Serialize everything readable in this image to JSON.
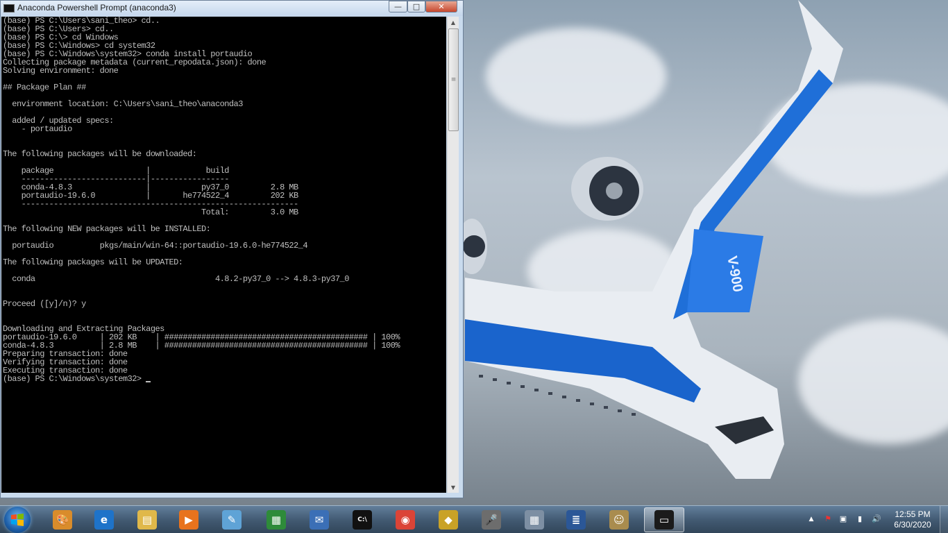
{
  "window": {
    "title": "Anaconda Powershell Prompt (anaconda3)",
    "minimize_glyph": "—",
    "maximize_glyph": "□",
    "close_glyph": "✕"
  },
  "console": {
    "lines": [
      "(base) PS C:\\Users\\sani_theo> cd..",
      "(base) PS C:\\Users> cd..",
      "(base) PS C:\\> cd Windows",
      "(base) PS C:\\Windows> cd system32",
      "(base) PS C:\\Windows\\system32> conda install portaudio",
      "Collecting package metadata (current_repodata.json): done",
      "Solving environment: done",
      "",
      "## Package Plan ##",
      "",
      "  environment location: C:\\Users\\sani_theo\\anaconda3",
      "",
      "  added / updated specs:",
      "    - portaudio",
      "",
      "",
      "The following packages will be downloaded:",
      "",
      "    package                    |            build",
      "    ---------------------------|-----------------",
      "    conda-4.8.3                |           py37_0         2.8 MB",
      "    portaudio-19.6.0           |       he774522_4         202 KB",
      "    ------------------------------------------------------------",
      "                                           Total:         3.0 MB",
      "",
      "The following NEW packages will be INSTALLED:",
      "",
      "  portaudio          pkgs/main/win-64::portaudio-19.6.0-he774522_4",
      "",
      "The following packages will be UPDATED:",
      "",
      "  conda                                       4.8.2-py37_0 --> 4.8.3-py37_0",
      "",
      "",
      "Proceed ([y]/n)? y",
      "",
      "",
      "Downloading and Extracting Packages",
      "portaudio-19.6.0     | 202 KB    | ############################################ | 100%",
      "conda-4.8.3          | 2.8 MB    | ############################################ | 100%",
      "Preparing transaction: done",
      "Verifying transaction: done",
      "Executing transaction: done"
    ],
    "prompt": "(base) PS C:\\Windows\\system32> "
  },
  "scrollbar": {
    "up_glyph": "▲",
    "down_glyph": "▼",
    "thumb_glyph": "≡"
  },
  "taskbar": {
    "items": [
      {
        "name": "paint-icon",
        "color": "#d98c2b",
        "glyph": "🎨"
      },
      {
        "name": "internet-explorer-icon",
        "color": "#1e73c9",
        "glyph": "e"
      },
      {
        "name": "file-explorer-icon",
        "color": "#e0b84a",
        "glyph": "▤"
      },
      {
        "name": "media-player-icon",
        "color": "#e8731d",
        "glyph": "▶"
      },
      {
        "name": "notepad-icon",
        "color": "#5fa3d6",
        "glyph": "✎"
      },
      {
        "name": "spreadsheet-icon",
        "color": "#2e8b3a",
        "glyph": "▦"
      },
      {
        "name": "mail-icon",
        "color": "#3b6fb6",
        "glyph": "✉"
      },
      {
        "name": "command-prompt-icon",
        "color": "#111111",
        "glyph": "C:\\"
      },
      {
        "name": "chrome-icon",
        "color": "#db4437",
        "glyph": "◉"
      },
      {
        "name": "chip-icon",
        "color": "#c9a227",
        "glyph": "◆"
      },
      {
        "name": "microphone-icon",
        "color": "#6d6d6d",
        "glyph": "🎤"
      },
      {
        "name": "calculator-icon",
        "color": "#7d8fa3",
        "glyph": "▦"
      },
      {
        "name": "document-icon",
        "color": "#2b5797",
        "glyph": "≣"
      },
      {
        "name": "robot-icon",
        "color": "#a98c4e",
        "glyph": "☺"
      },
      {
        "name": "powershell-taskbar-icon",
        "color": "#1b1b1b",
        "glyph": "▭"
      }
    ],
    "tray": {
      "show_hidden_glyph": "▲",
      "flag_glyph": "⚑",
      "device_glyph": "▣",
      "network_glyph": "▮",
      "volume_glyph": "🔊"
    },
    "clock": {
      "time": "12:55 PM",
      "date": "6/30/2020"
    }
  }
}
